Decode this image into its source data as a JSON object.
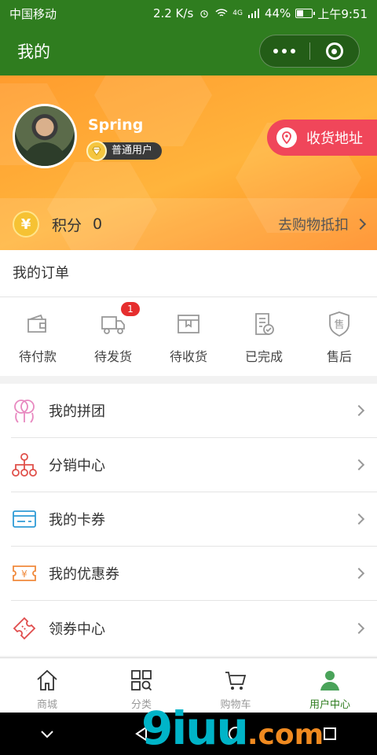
{
  "status_bar": {
    "carrier": "中国移动",
    "speed": "2.2 K/s",
    "network": "4G",
    "battery": "44%",
    "battery_level": 0.44,
    "time": "上午9:51"
  },
  "nav": {
    "title": "我的"
  },
  "profile": {
    "name": "Spring",
    "level": "普通用户",
    "address_button": "收货地址"
  },
  "points": {
    "coin_symbol": "¥",
    "label": "积分",
    "value": "0",
    "action": "去购物抵扣"
  },
  "orders": {
    "title": "我的订单",
    "items": [
      {
        "label": "待付款",
        "icon": "wallet-icon"
      },
      {
        "label": "待发货",
        "icon": "truck-icon",
        "badge": "1"
      },
      {
        "label": "待收货",
        "icon": "package-icon"
      },
      {
        "label": "已完成",
        "icon": "completed-icon"
      },
      {
        "label": "售后",
        "icon": "after-sale-icon",
        "glyph": "售"
      }
    ]
  },
  "menu": [
    {
      "label": "我的拼团",
      "icon": "group-buy-icon",
      "color": "#e889c0"
    },
    {
      "label": "分销中心",
      "icon": "distribution-icon",
      "color": "#e0504a"
    },
    {
      "label": "我的卡券",
      "icon": "card-icon",
      "color": "#2e9bd6"
    },
    {
      "label": "我的优惠券",
      "icon": "coupon-icon",
      "color": "#f08a3c",
      "glyph": "¥"
    },
    {
      "label": "领券中心",
      "icon": "ticket-icon",
      "color": "#e04c4c"
    }
  ],
  "tabbar": [
    {
      "label": "商城",
      "icon": "home-icon"
    },
    {
      "label": "分类",
      "icon": "category-icon"
    },
    {
      "label": "购物车",
      "icon": "cart-icon"
    },
    {
      "label": "用户中心",
      "icon": "user-icon",
      "active": true
    }
  ],
  "colors": {
    "brand_green": "#2f7d1f",
    "hero_orange": "#ff9c2e",
    "address_red": "#f0465a",
    "badge_red": "#e62e2e"
  },
  "watermark": {
    "main": "9iuu",
    "suffix": ".com"
  }
}
